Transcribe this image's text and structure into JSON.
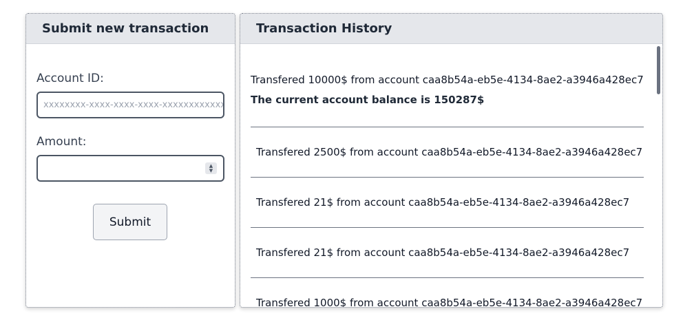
{
  "submit_panel": {
    "title": "Submit new transaction",
    "account_label": "Account ID:",
    "account_placeholder": "xxxxxxxx-xxxx-xxxx-xxxx-xxxxxxxxxxxx",
    "account_value": "",
    "amount_label": "Amount:",
    "amount_value": "",
    "submit_label": "Submit"
  },
  "history_panel": {
    "title": "Transaction History",
    "items": [
      {
        "text": "Transfered 10000$ from account caa8b54a-eb5e-4134-8ae2-a3946a428ec7",
        "balance": "The current account balance is 150287$"
      },
      {
        "text": "Transfered 2500$ from account caa8b54a-eb5e-4134-8ae2-a3946a428ec7"
      },
      {
        "text": "Transfered 21$ from account caa8b54a-eb5e-4134-8ae2-a3946a428ec7"
      },
      {
        "text": "Transfered 21$ from account caa8b54a-eb5e-4134-8ae2-a3946a428ec7"
      },
      {
        "text": "Transfered 1000$ from account caa8b54a-eb5e-4134-8ae2-a3946a428ec7"
      }
    ]
  }
}
